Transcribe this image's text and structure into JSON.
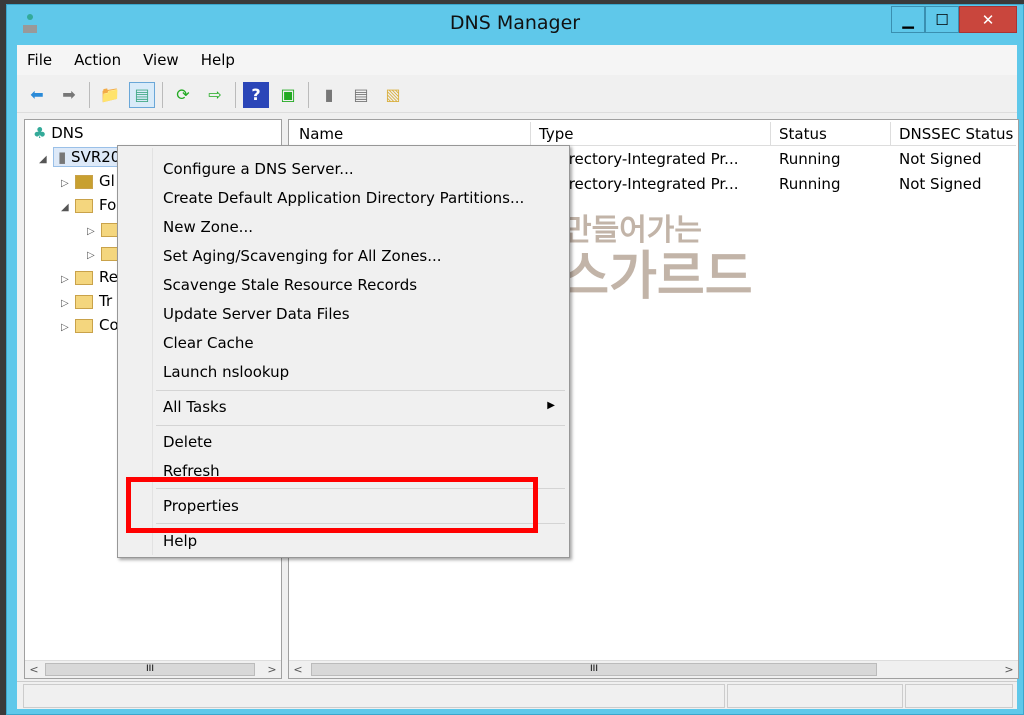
{
  "window": {
    "title": "DNS Manager",
    "minimize": "▁",
    "maximize": "☐",
    "close": "✕"
  },
  "menu": [
    "File",
    "Action",
    "View",
    "Help"
  ],
  "tree": {
    "root": "DNS",
    "server": "SVR2012",
    "children": [
      "Gl",
      "Fo",
      "Re",
      "Tr",
      "Co"
    ]
  },
  "list": {
    "columns": [
      "Name",
      "Type",
      "Status",
      "DNSSEC Status"
    ],
    "rows": [
      {
        "type": "e Directory-Integrated Pr...",
        "status": "Running",
        "dnssec": "Not Signed"
      },
      {
        "type": "e Directory-Integrated Pr...",
        "status": "Running",
        "dnssec": "Not Signed"
      }
    ]
  },
  "context_menu": {
    "items": [
      "Configure a DNS Server...",
      "Create Default Application Directory Partitions...",
      "New Zone...",
      "Set Aging/Scavenging for All Zones...",
      "Scavenge Stale Resource Records",
      "Update Server Data Files",
      "Clear Cache",
      "Launch nslookup",
      "All Tasks",
      "Delete",
      "Refresh",
      "Properties",
      "Help"
    ],
    "highlighted": "Properties",
    "highlight_color": "#ff0000"
  },
  "watermark": {
    "line1": "만들어가는",
    "line2": "아스가르드"
  },
  "scroll": {
    "thumb": "III"
  }
}
